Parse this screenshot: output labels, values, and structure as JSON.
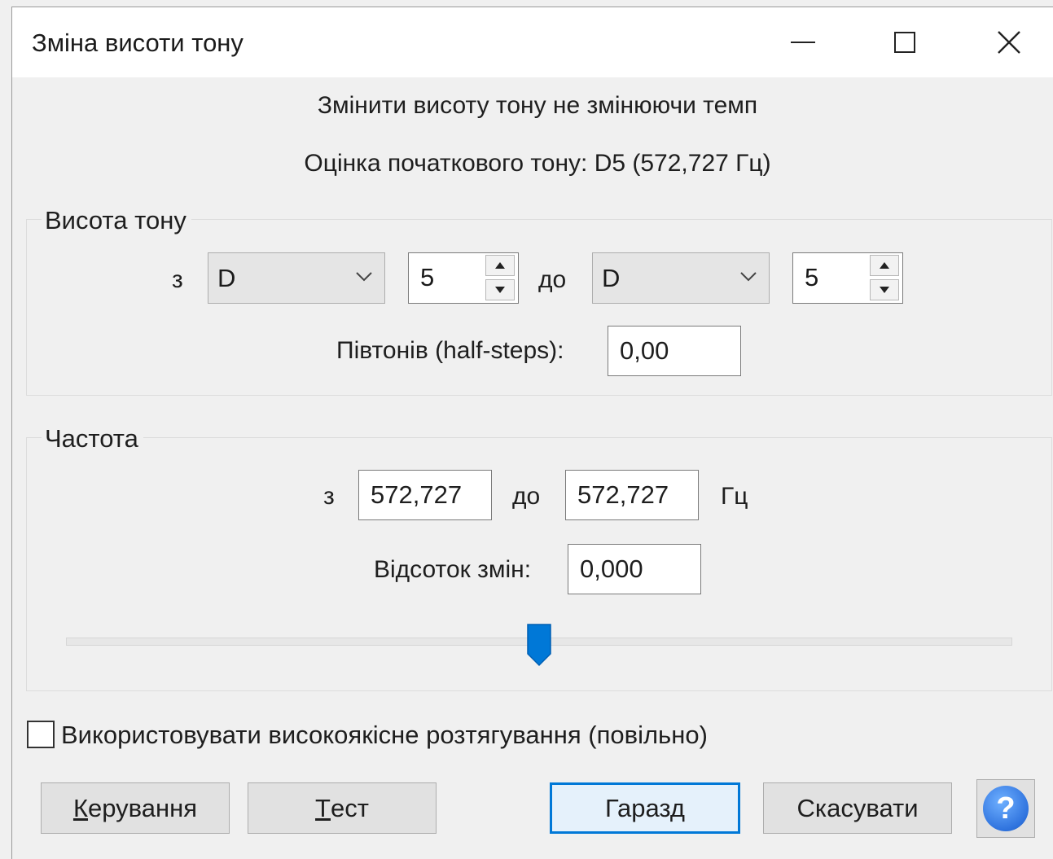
{
  "window": {
    "title": "Зміна висоти тону"
  },
  "header": {
    "description": "Змінити висоту тону не змінюючи темп",
    "estimate": "Оцінка початкового тону: D5 (572,727 Гц)"
  },
  "pitch": {
    "group_label": "Висота тону",
    "from_label": "з",
    "from_note": "D",
    "from_octave": "5",
    "to_label": "до",
    "to_note": "D",
    "to_octave": "5",
    "semitones_label": "Півтонів (half-steps):",
    "semitones_value": "0,00"
  },
  "frequency": {
    "group_label": "Частота",
    "from_label": "з",
    "from_value": "572,727",
    "to_label": "до",
    "to_value": "572,727",
    "unit": "Гц",
    "percent_label": "Відсоток змін:",
    "percent_value": "0,000",
    "slider_position": 0.5
  },
  "options": {
    "high_quality_label": "Використовувати високоякісне розтягування (повільно)",
    "high_quality_checked": false
  },
  "buttons": {
    "manage_first": "К",
    "manage_rest": "ерування",
    "test_first": "Т",
    "test_rest": "ест",
    "ok": "Гаразд",
    "cancel": "Скасувати",
    "help": "?"
  },
  "colors": {
    "accent": "#0078d7",
    "slider_thumb": "#0078d7",
    "background": "#f0f0f0"
  }
}
